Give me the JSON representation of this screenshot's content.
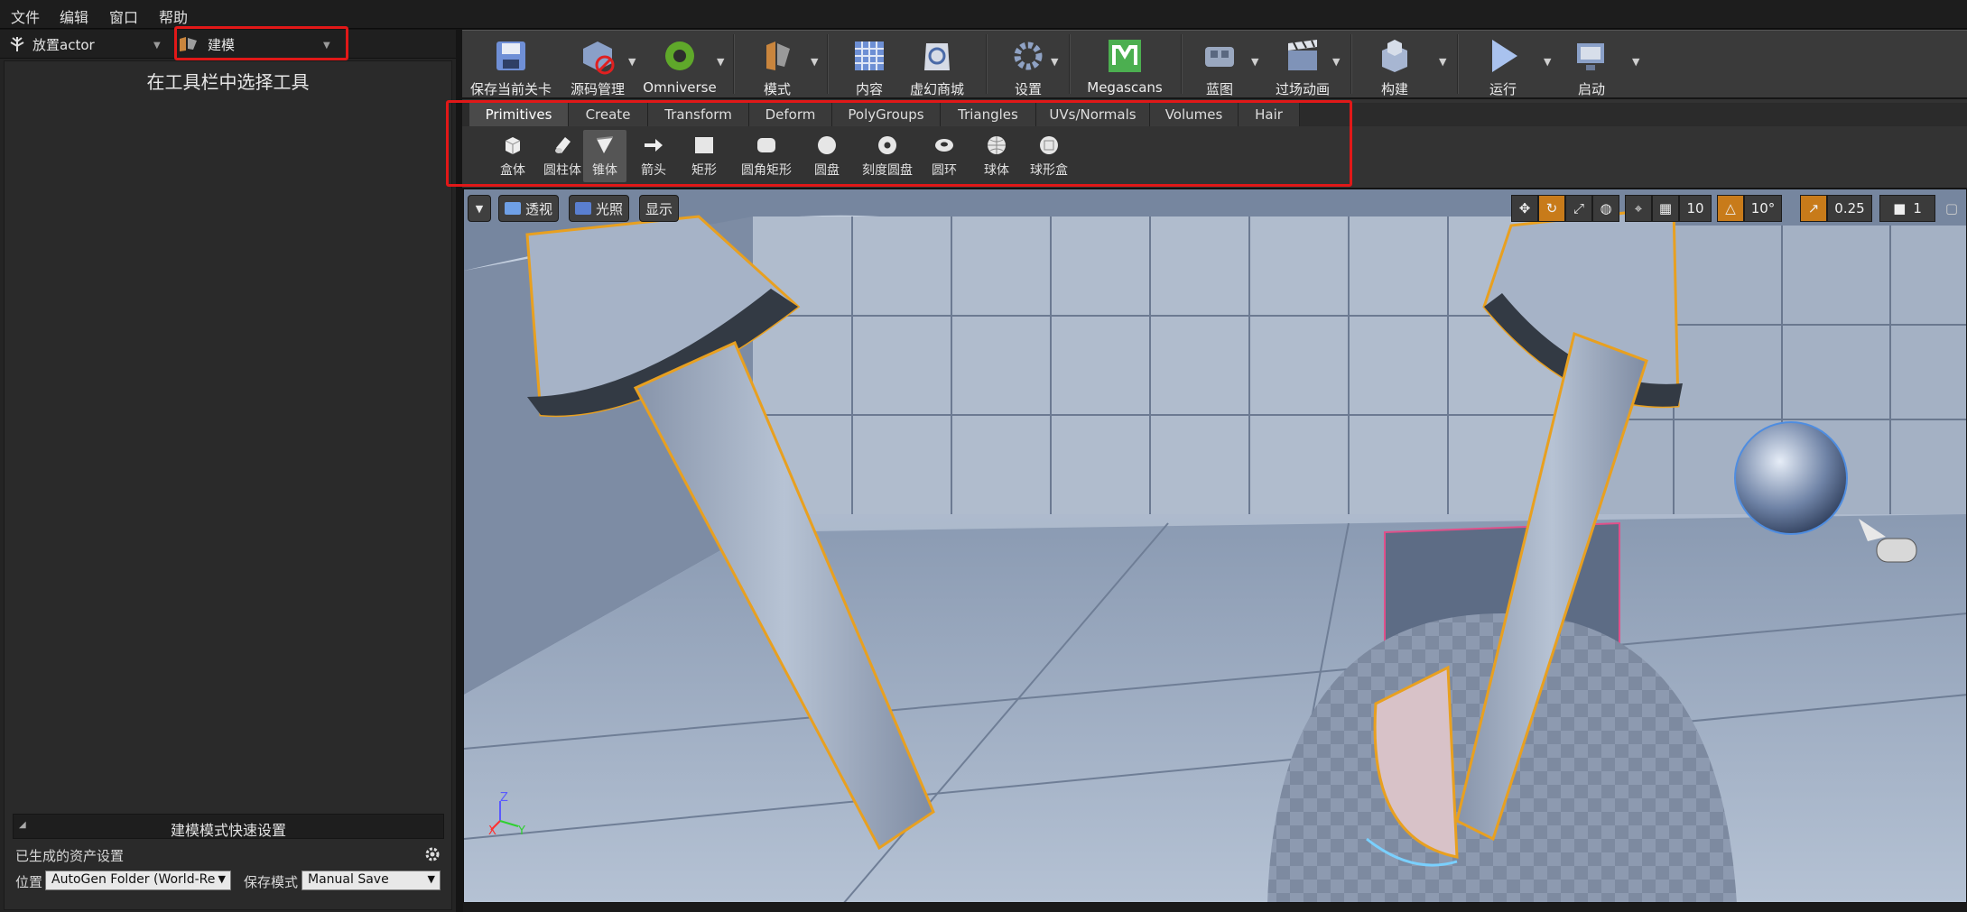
{
  "menu": [
    "文件",
    "编辑",
    "窗口",
    "帮助"
  ],
  "modes": {
    "place_actor": "放置actor",
    "modeling": "建模"
  },
  "left_panel": {
    "hint": "在工具栏中选择工具",
    "quick_settings_title": "建模模式快速设置",
    "asset_settings": "已生成的资产设置",
    "location_label": "位置",
    "location_value": "AutoGen Folder (World-Re",
    "save_mode_label": "保存模式",
    "save_mode_value": "Manual Save"
  },
  "toolbar": [
    {
      "label": "保存当前关卡",
      "icon": "save-icon"
    },
    {
      "label": "源码管理",
      "icon": "source-control-icon"
    },
    {
      "label": "Omniverse",
      "icon": "omniverse-icon"
    },
    {
      "label": "模式",
      "icon": "modes-icon"
    },
    {
      "label": "内容",
      "icon": "content-icon"
    },
    {
      "label": "虚幻商城",
      "icon": "marketplace-icon"
    },
    {
      "label": "设置",
      "icon": "settings-icon"
    },
    {
      "label": "Megascans",
      "icon": "megascans-icon"
    },
    {
      "label": "蓝图",
      "icon": "blueprint-icon"
    },
    {
      "label": "过场动画",
      "icon": "cinematics-icon"
    },
    {
      "label": "构建",
      "icon": "build-icon"
    },
    {
      "label": "运行",
      "icon": "play-icon"
    },
    {
      "label": "启动",
      "icon": "launch-icon"
    }
  ],
  "palette": {
    "tabs": [
      "Primitives",
      "Create",
      "Transform",
      "Deform",
      "PolyGroups",
      "Triangles",
      "UVs/Normals",
      "Volumes",
      "Hair"
    ],
    "active_tab": "Primitives",
    "items": [
      {
        "label": "盒体",
        "icon": "box-icon"
      },
      {
        "label": "圆柱体",
        "icon": "cylinder-icon"
      },
      {
        "label": "锥体",
        "icon": "cone-icon"
      },
      {
        "label": "箭头",
        "icon": "arrow-icon"
      },
      {
        "label": "矩形",
        "icon": "rectangle-icon"
      },
      {
        "label": "圆角矩形",
        "icon": "rounded-rectangle-icon"
      },
      {
        "label": "圆盘",
        "icon": "disc-icon"
      },
      {
        "label": "刻度圆盘",
        "icon": "punctured-disc-icon"
      },
      {
        "label": "圆环",
        "icon": "torus-icon"
      },
      {
        "label": "球体",
        "icon": "sphere-icon"
      },
      {
        "label": "球形盒",
        "icon": "sphere-box-icon"
      }
    ],
    "active_item": "锥体"
  },
  "viewport": {
    "perspective": "透视",
    "lit": "光照",
    "show": "显示",
    "grid_snap": "10",
    "rotation_snap": "10°",
    "scale_snap": "0.25",
    "camera_speed": "1",
    "axis_labels": {
      "z": "Z",
      "x": "X",
      "y": "Y"
    }
  },
  "colors": {
    "highlight_red": "#e11818",
    "selection_orange": "#e8a020",
    "megascans_green": "#4caf50"
  }
}
